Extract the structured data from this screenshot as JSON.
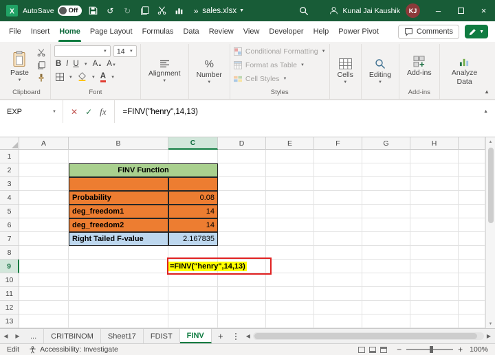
{
  "titlebar": {
    "autosave_label": "AutoSave",
    "autosave_state": "Off",
    "filename": "sales.xlsx",
    "user_name": "Kunal Jai Kaushik",
    "user_initials": "KJ"
  },
  "menubar": {
    "tabs": [
      "File",
      "Insert",
      "Home",
      "Page Layout",
      "Formulas",
      "Data",
      "Review",
      "View",
      "Developer",
      "Help",
      "Power Pivot"
    ],
    "active_tab": "Home",
    "comments_label": "Comments"
  },
  "ribbon": {
    "paste_label": "Paste",
    "clipboard_group_label": "Clipboard",
    "font_group_label": "Font",
    "font_size": "14",
    "bold": "B",
    "italic": "I",
    "underline": "U",
    "font_color_letter": "A",
    "alignment_label": "Alignment",
    "number_label": "Number",
    "number_icon": "%",
    "conditional_formatting_label": "Conditional Formatting",
    "format_as_table_label": "Format as Table",
    "cell_styles_label": "Cell Styles",
    "styles_group_label": "Styles",
    "cells_label": "Cells",
    "editing_label": "Editing",
    "addins_label": "Add-ins",
    "addins_group_label": "Add-ins",
    "analyze_data_label": "Analyze Data"
  },
  "formula_bar": {
    "name_box": "EXP",
    "fx_label": "fx",
    "formula": "=FINV(\"henry\",14,13)"
  },
  "grid": {
    "columns": [
      "A",
      "B",
      "C",
      "D",
      "E",
      "F",
      "G",
      "H"
    ],
    "rows": [
      "1",
      "2",
      "3",
      "4",
      "5",
      "6",
      "7",
      "8",
      "9",
      "10",
      "11",
      "12",
      "13"
    ],
    "active_column": "C",
    "active_row": "9",
    "table": {
      "title": "FINV Function",
      "rows": [
        {
          "label": "Probability",
          "value": "0.08"
        },
        {
          "label": "deg_freedom1",
          "value": "14"
        },
        {
          "label": "deg_freedom2",
          "value": "14"
        },
        {
          "label": "Right Tailed F-value",
          "value": "2.167835"
        }
      ]
    },
    "active_cell_formula": "=FINV(\"henry\",14,13)"
  },
  "sheet_tabs": {
    "overflow": "...",
    "tabs": [
      "CRITBINOM",
      "Sheet17",
      "FDIST",
      "FINV"
    ],
    "active": "FINV",
    "add_label": "+"
  },
  "status_bar": {
    "mode": "Edit",
    "accessibility": "Accessibility: Investigate",
    "zoom_out": "−",
    "zoom_in": "+",
    "zoom": "100%"
  },
  "colors": {
    "titlebar": "#185C37",
    "accent": "#107C41",
    "table_header_green": "#A9D08E",
    "table_orange": "#ED7D31",
    "table_blue": "#BDD7EE",
    "highlight_yellow": "#FFFF00",
    "annotation_red": "#E02020"
  }
}
